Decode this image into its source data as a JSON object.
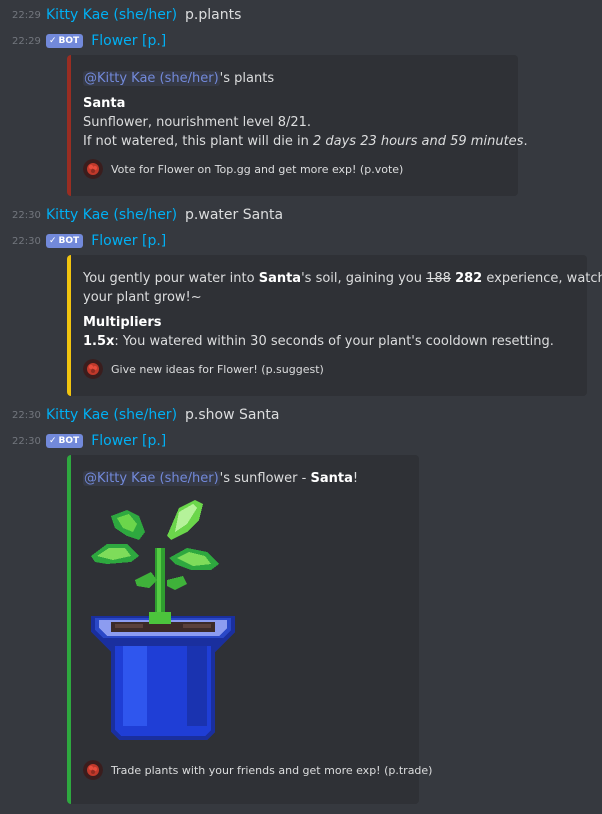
{
  "messages": [
    {
      "time": "22:29",
      "author": "Kitty Kae (she/her)",
      "content": "p.plants"
    },
    {
      "time": "22:29",
      "badge": "BOT",
      "author": "Flower [p.]"
    },
    {
      "time": "22:30",
      "author": "Kitty Kae (she/her)",
      "content": "p.water Santa"
    },
    {
      "time": "22:30",
      "badge": "BOT",
      "author": "Flower [p.]"
    },
    {
      "time": "22:30",
      "author": "Kitty Kae (she/her)",
      "content": "p.show Santa"
    },
    {
      "time": "22:30",
      "badge": "BOT",
      "author": "Flower [p.]"
    }
  ],
  "embeds": {
    "plants": {
      "accent": "#992d22",
      "mention": "@Kitty Kae (she/her)",
      "title_suffix": "'s plants",
      "plant_name": "Santa",
      "line1": "Sunflower, nourishment level 8/21.",
      "line2_prefix": "If not watered, this plant will die in ",
      "line2_time": "2 days 23 hours and 59 minutes",
      "line2_suffix": ".",
      "footer": "Vote for Flower on Top.gg and get more exp! (p.vote)"
    },
    "water": {
      "accent": "#f1c40f",
      "t1": "You gently pour water into ",
      "t2": "Santa",
      "t3": "'s soil, gaining you ",
      "old_exp": "188",
      "new_exp": "282",
      "t4": " experience, watching",
      "t5": "your plant grow!~",
      "field_name": "Multipliers",
      "mult": "1.5x",
      "mult_text": ": You watered within 30 seconds of your plant's cooldown resetting.",
      "footer": "Give new ideas for Flower! (p.suggest)"
    },
    "show": {
      "accent": "#2ea83f",
      "mention": "@Kitty Kae (she/her)",
      "t1": "'s sunflower - ",
      "t2": "Santa",
      "t3": "!",
      "footer": "Trade plants with your friends and get more exp! (p.trade)"
    }
  },
  "icons": {
    "badge_check": "check-icon",
    "footer_icon": "flower-avatar-icon"
  }
}
